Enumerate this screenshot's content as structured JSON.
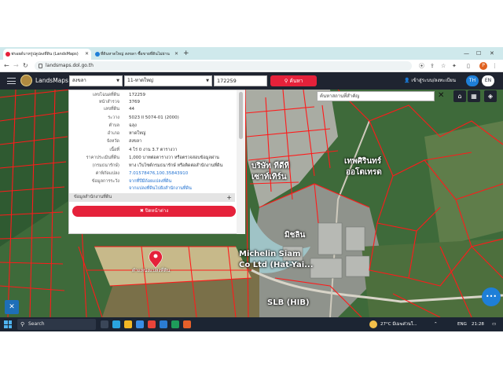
{
  "browser": {
    "tabs": [
      {
        "label": "ฟรอยด์บาหรู่ปลูปลงที่ดิน (LandsMaps)",
        "favicon_color": "#e5213a"
      },
      {
        "label": "ที่ดินหาดใหญ่ สงขลา ซื้อขายที่ดินไม่ผ่าน",
        "favicon_color": "#1e7fd8"
      }
    ],
    "new_tab": "+",
    "url": "landsmaps.dol.go.th",
    "profile_initial": "P"
  },
  "header": {
    "brand": "LandsMaps",
    "province": "สงขลา",
    "district": "11-หาดใหญ่",
    "parcel_input": "172259",
    "search_button": "ค้นหา",
    "login_label": "เข้าสู่ระบบ/ลงทะเบียน",
    "lang_th": "TH",
    "lang_en": "EN"
  },
  "map": {
    "search_placeholder": "ค้นหาสถานที่สำคัญ",
    "pin_label": "ตำแหน่งแปลงที่ดิน",
    "labels": [
      {
        "text": "บริษัท ทีดีที"
      },
      {
        "text": "เซาท์เทิร์น"
      },
      {
        "text": "เทพศิรินทร์"
      },
      {
        "text": "ออโตเทรด"
      },
      {
        "text": "มิชลิน"
      },
      {
        "text": "Michelin Siam"
      },
      {
        "text": "Co Ltd (Hat-Yai..."
      },
      {
        "text": "SLB (HIB)"
      }
    ]
  },
  "panel": {
    "rows": [
      {
        "key": "เลขโฉนดที่ดิน",
        "value": "172259"
      },
      {
        "key": "หน้าสำรวจ",
        "value": "3769"
      },
      {
        "key": "เลขที่ดิน",
        "value": "44"
      },
      {
        "key": "ระวาง",
        "value": "5023 II 5074-01 (2000)"
      },
      {
        "key": "ตำบล",
        "value": "ฉลุง"
      },
      {
        "key": "อำเภอ",
        "value": "หาดใหญ่"
      },
      {
        "key": "จังหวัด",
        "value": "สงขลา"
      },
      {
        "key": "เนื้อที่",
        "value": "4 ไร่ 0 งาน 3.7 ตารางวา"
      },
      {
        "key": "ราคาประเมินที่ดิน",
        "value": "1,000 บาทต่อตารางวา หรือตรวจสอบข้อมูลผ่าน"
      },
      {
        "key": "(กรมธนารักษ์)",
        "value": "ทาง เว็บไซต์กรมธนารักษ์ หรือติดต่อสำนักงานที่ดิน"
      },
      {
        "key": "ค่าพิกัดแปลง",
        "value": "7.01578476,100.35843910",
        "link": true
      },
      {
        "key": "ข้อมูลการระวัง",
        "value": "จากที่ปีมีถ้อยแปลงที่ดิน",
        "link": true
      },
      {
        "key": "",
        "value": "จากแปลงที่ดินไปยังสำนักงานที่ดิน",
        "link": true
      }
    ],
    "section_label": "ข้อมูลสำนักงานที่ดิน",
    "section_toggle": "+",
    "close_button": "✖ ปิดหน้าต่าง"
  },
  "taskbar": {
    "search": "Search",
    "weather": "27°C มีเมฆส่วนใ...",
    "lang": "ENG",
    "time": "21:28"
  },
  "colors": {
    "header_bg": "#1f2430",
    "accent_red": "#e5213a",
    "accent_blue": "#1e7fd8",
    "parcel_line": "#ff1a1a"
  }
}
